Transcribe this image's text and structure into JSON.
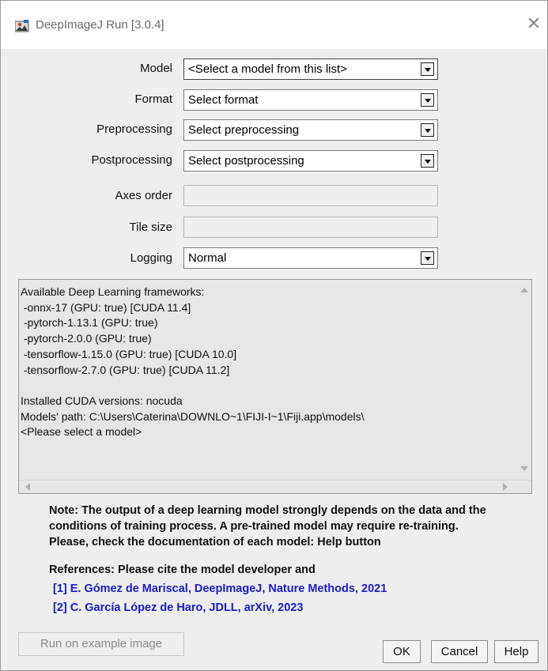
{
  "window": {
    "title": "DeepImageJ Run [3.0.4]",
    "close_glyph": "✕"
  },
  "form": {
    "model": {
      "label": "Model",
      "value": "<Select a model from this list>"
    },
    "format": {
      "label": "Format",
      "value": "Select format"
    },
    "preprocessing": {
      "label": "Preprocessing",
      "value": "Select preprocessing"
    },
    "postprocessing": {
      "label": "Postprocessing",
      "value": "Select postprocessing"
    },
    "axes_order": {
      "label": "Axes order",
      "value": ""
    },
    "tile_size": {
      "label": "Tile size",
      "value": ""
    },
    "logging": {
      "label": "Logging",
      "value": "Normal"
    }
  },
  "info_text": "Available Deep Learning frameworks:\n -onnx-17 (GPU: true) [CUDA 11.4]\n -pytorch-1.13.1 (GPU: true)\n -pytorch-2.0.0 (GPU: true)\n -tensorflow-1.15.0 (GPU: true) [CUDA 10.0]\n -tensorflow-2.7.0 (GPU: true) [CUDA 11.2]\n\nInstalled CUDA versions: nocuda\nModels' path: C:\\Users\\Caterina\\DOWNLO~1\\FIJI-I~1\\Fiji.app\\models\\\n<Please select a model>",
  "note": {
    "line1": "Note: The output of a deep learning model strongly depends on the data and the",
    "line2": "conditions of training process. A pre-trained model may require re-training.",
    "line3": "Please, check the documentation of each model: Help button"
  },
  "references": {
    "header": "References: Please cite the model developer and",
    "ref1": "[1] E. Gómez de Mariscal, DeepImageJ, Nature Methods, 2021",
    "ref2": "[2] C. García López de Haro, JDLL, arXiv, 2023",
    "link_color": "#1a1ad0"
  },
  "buttons": {
    "run_example": "Run on example image",
    "ok": "OK",
    "cancel": "Cancel",
    "help": "Help"
  },
  "icons": {
    "title": "deepimagej-app-icon",
    "close": "close-icon",
    "dropdown": "chevron-down-icon"
  }
}
